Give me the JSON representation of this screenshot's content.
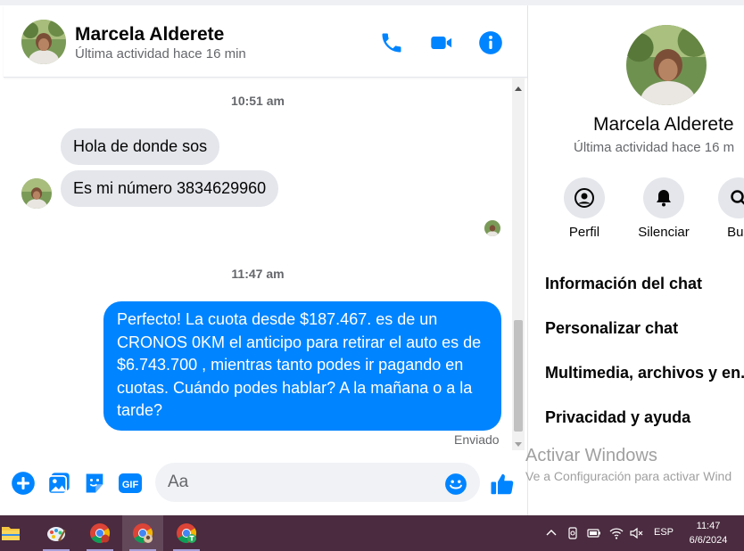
{
  "chat_header": {
    "name": "Marcela Alderete",
    "status": "Última actividad hace 16 min",
    "actions": [
      "phone-icon",
      "video-camera-icon",
      "info-icon"
    ]
  },
  "messages": [
    {
      "type": "timestamp",
      "text": "10:51 am"
    },
    {
      "type": "incoming",
      "text": "Hola de donde sos"
    },
    {
      "type": "incoming",
      "text": "Es mi número 3834629960"
    },
    {
      "type": "timestamp",
      "text": "11:47 am"
    },
    {
      "type": "outgoing",
      "text": "Perfecto! La cuota desde $187.467. es de un CRONOS 0KM el anticipo para retirar el auto es de $6.743.700 , mientras tanto podes ir pagando en cuotas. Cuándo podes hablar? A la mañana o a la tarde?"
    }
  ],
  "sent_status": "Enviado",
  "composer": {
    "placeholder": "Aa",
    "icons": [
      "add-icon",
      "image-icon",
      "sticker-icon",
      "gif-icon",
      "emoji-icon",
      "like-icon"
    ],
    "gif_label": "GIF"
  },
  "info_panel": {
    "name": "Marcela Alderete",
    "status": "Última actividad hace 16 m",
    "actions": [
      {
        "label": "Perfil",
        "icon": "profile-icon"
      },
      {
        "label": "Silenciar",
        "icon": "bell-icon"
      },
      {
        "label": "Bus",
        "icon": "search-icon"
      }
    ],
    "menu": [
      "Información del chat",
      "Personalizar chat",
      "Multimedia, archivos y en.",
      "Privacidad y ayuda"
    ]
  },
  "watermark": {
    "title": "Activar Windows",
    "subtitle": "Ve a Configuración para activar Wind"
  },
  "taskbar": {
    "apps": [
      "file-explorer-icon",
      "paint-icon",
      "chrome-icon",
      "chrome-profile-icon",
      "chrome-profile-t-icon"
    ],
    "language": "ESP",
    "time": "11:47",
    "date": "6/6/2024"
  },
  "colors": {
    "accent": "#0084ff",
    "incoming_bubble": "#e4e6eb",
    "taskbar": "#4a2b3f"
  }
}
